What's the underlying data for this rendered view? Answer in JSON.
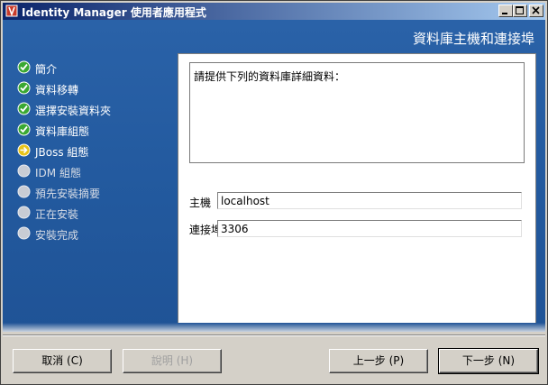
{
  "window": {
    "title": "Identity Manager 使用者應用程式"
  },
  "page": {
    "heading": "資料庫主機和連接埠"
  },
  "steps": [
    {
      "label": "簡介",
      "status": "done"
    },
    {
      "label": "資料移轉",
      "status": "done"
    },
    {
      "label": "選擇安裝資料夾",
      "status": "done"
    },
    {
      "label": "資料庫組態",
      "status": "done"
    },
    {
      "label": "JBoss 組態",
      "status": "current"
    },
    {
      "label": "IDM 組態",
      "status": "pending"
    },
    {
      "label": "預先安裝摘要",
      "status": "pending"
    },
    {
      "label": "正在安裝",
      "status": "pending"
    },
    {
      "label": "安裝完成",
      "status": "pending"
    }
  ],
  "form": {
    "message": "請提供下列的資料庫詳細資料：",
    "host_label": "主機",
    "host_value": "localhost",
    "port_label": "連接埠",
    "port_value": "3306"
  },
  "buttons": {
    "cancel": "取消 (C)",
    "help": "說明 (H)",
    "back": "上一步 (P)",
    "next": "下一步 (N)"
  },
  "colors": {
    "step_done": "#3aa832",
    "step_current": "#e8c41a",
    "step_pending": "#c8ccd4"
  }
}
